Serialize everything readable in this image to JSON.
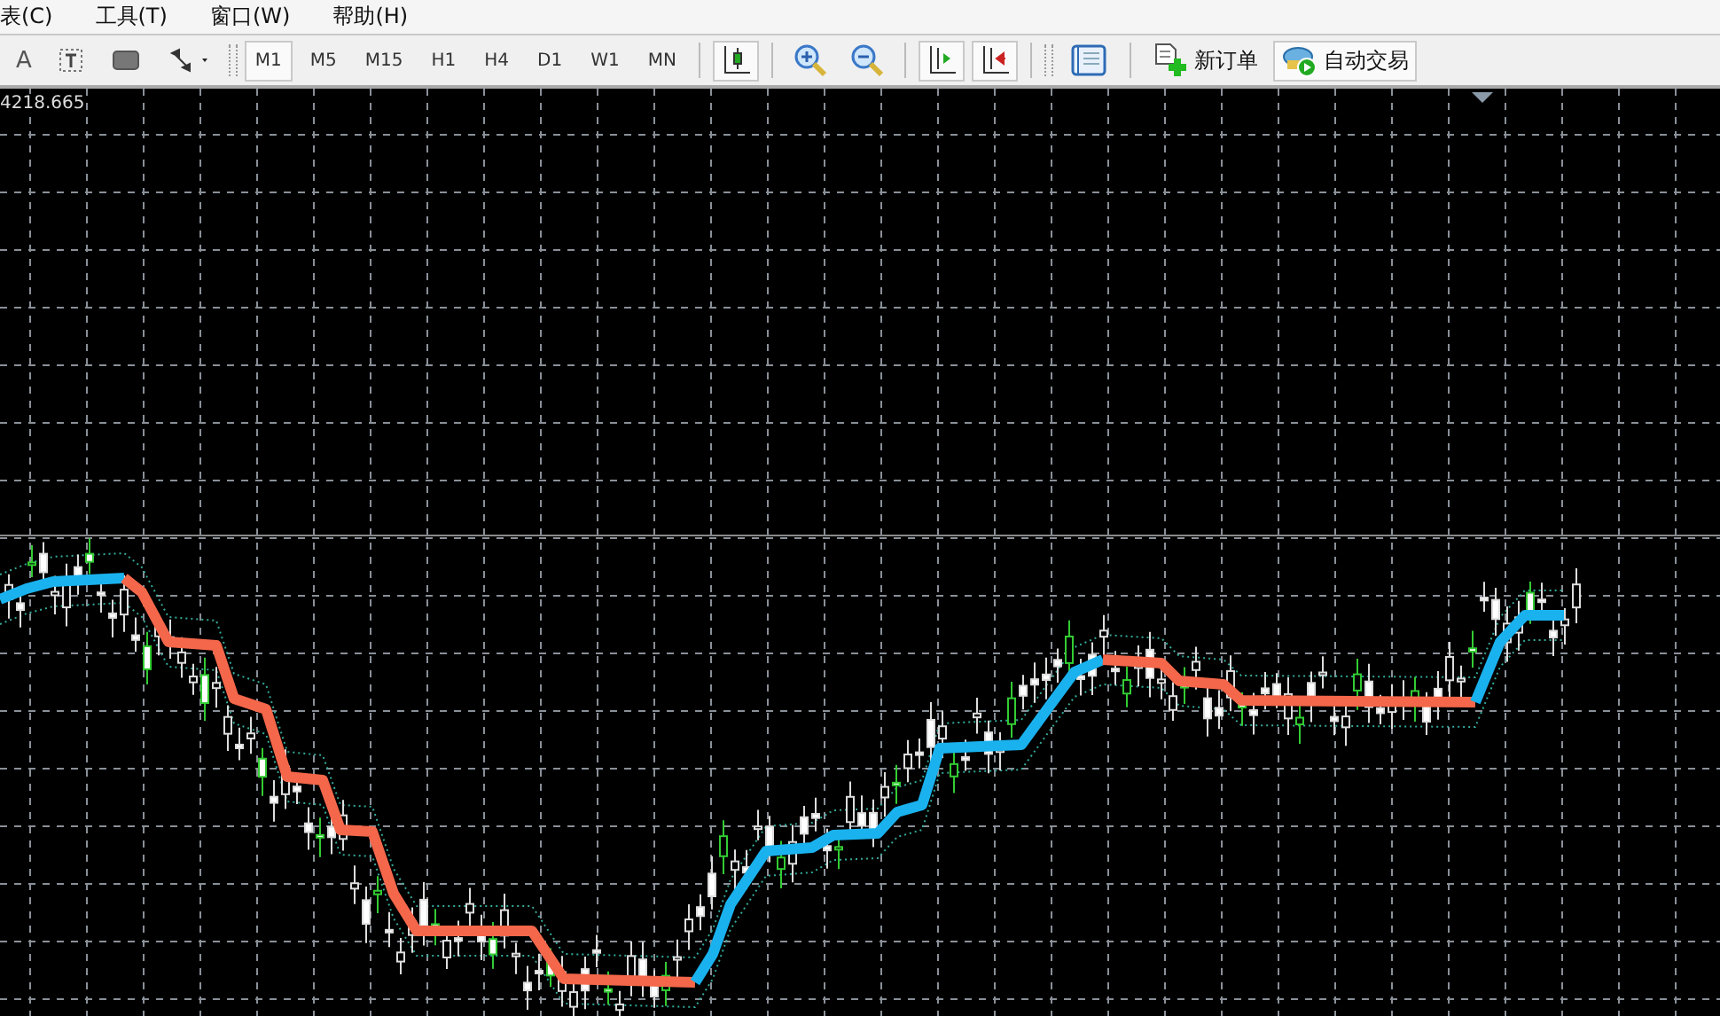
{
  "menu": [
    {
      "label": "表(C)"
    },
    {
      "label": "工具(T)"
    },
    {
      "label": "窗口(W)"
    },
    {
      "label": "帮助(H)"
    }
  ],
  "toolbar": {
    "text_tool_label": "A",
    "timeframes": [
      {
        "label": "M1",
        "selected": true
      },
      {
        "label": "M5",
        "selected": false
      },
      {
        "label": "M15",
        "selected": false
      },
      {
        "label": "H1",
        "selected": false
      },
      {
        "label": "H4",
        "selected": false
      },
      {
        "label": "D1",
        "selected": false
      },
      {
        "label": "W1",
        "selected": false
      },
      {
        "label": "MN",
        "selected": false
      }
    ],
    "chart_toggles": [
      {
        "pressed": true
      },
      {
        "pressed": false
      },
      {
        "pressed": false
      },
      {
        "pressed": true
      },
      {
        "pressed": true
      }
    ],
    "new_order": {
      "label": "新订单"
    },
    "auto_trading": {
      "label": "自动交易",
      "pressed": true
    }
  },
  "chart": {
    "price_label": "4218.665"
  }
}
